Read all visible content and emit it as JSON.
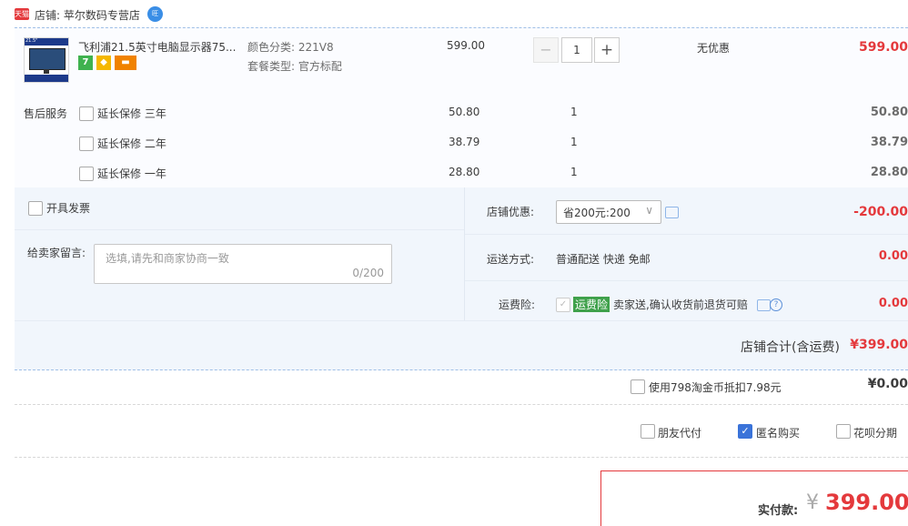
{
  "shop": {
    "tmall_label": "天猫",
    "name_text": "店铺: 苹尔数码专营店",
    "wangwang_label": "旺"
  },
  "item": {
    "thumb_badge": "21.5\"",
    "title": "飞利浦21.5英寸电脑显示器75...",
    "badge_7": "7",
    "sku_color": "颜色分类: 221V8",
    "sku_package": "套餐类型: 官方标配",
    "unit_price": "599.00",
    "quantity": "1",
    "minus_label": "−",
    "plus_label": "+",
    "discount": "无优惠",
    "subtotal": "599.00"
  },
  "after_sales": {
    "label": "售后服务",
    "options": [
      {
        "name": "延长保修 三年",
        "price": "50.80",
        "qty": "1",
        "total": "50.80"
      },
      {
        "name": "延长保修 二年",
        "price": "38.79",
        "qty": "1",
        "total": "38.79"
      },
      {
        "name": "延长保修 一年",
        "price": "28.80",
        "qty": "1",
        "total": "28.80"
      }
    ]
  },
  "invoice": {
    "label": "开具发票"
  },
  "memo": {
    "label": "给卖家留言:",
    "placeholder": "选填,请先和商家协商一致",
    "counter": "0/200"
  },
  "shop_discount": {
    "label": "店铺优惠:",
    "selected": "省200元:200",
    "amount": "-200.00"
  },
  "shipping": {
    "label": "运送方式:",
    "value": "普通配送 快递 免邮",
    "amount": "0.00"
  },
  "freight_insurance": {
    "label": "运费险:",
    "badge": "运费险",
    "description": "卖家送,确认收货前退货可赔",
    "amount": "0.00"
  },
  "shop_total": {
    "label": "店铺合计(含运费)",
    "amount": "¥399.00"
  },
  "taobao_gold": {
    "label": "使用798淘金币抵扣7.98元",
    "amount": "¥0.00"
  },
  "options": {
    "friend_pay": "朋友代付",
    "anonymous": "匿名购买",
    "huabei": "花呗分期"
  },
  "payment": {
    "label": "实付款:",
    "currency": "¥",
    "amount": "399.00"
  },
  "colors": {
    "accent_red": "#e4393c",
    "border_blue": "#9fbfe6",
    "check_blue": "#3a73d9",
    "insurance_green": "#3fa14b"
  }
}
